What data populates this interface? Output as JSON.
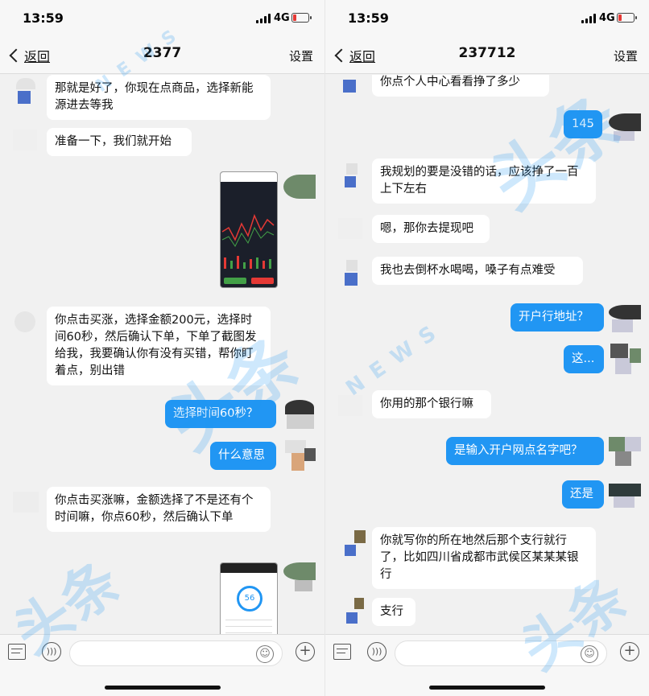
{
  "left": {
    "status": {
      "time": "13:59",
      "network": "4G"
    },
    "nav": {
      "back": "返回",
      "title": "2377",
      "settings": "设置"
    },
    "messages": [
      {
        "side": "in",
        "text": "那就是好了，你现在点商品，选择新能源进去等我"
      },
      {
        "side": "in",
        "text": "准备一下，我们就开始"
      },
      {
        "side": "out",
        "type": "image",
        "label": "trading-chart-screenshot"
      },
      {
        "side": "in",
        "text": "你点击买涨，选择金额200元，选择时间60秒，然后确认下单，下单了截图发给我，我要确认你有没有买错，帮你盯着点，别出错"
      },
      {
        "side": "out",
        "text": "选择时间60秒？"
      },
      {
        "side": "out",
        "text": "什么意思"
      },
      {
        "side": "in",
        "text": "你点击买涨嘛，金额选择了不是还有个时间嘛，你点60秒，然后确认下单"
      },
      {
        "side": "out",
        "type": "image",
        "label": "order-countdown-screenshot"
      }
    ],
    "thumb2": {
      "countdown": "56"
    }
  },
  "right": {
    "status": {
      "time": "13:59",
      "network": "4G"
    },
    "nav": {
      "back": "返回",
      "title": "237712",
      "settings": "设置"
    },
    "messages": [
      {
        "side": "in",
        "text": "你点个人中心看看挣了多少"
      },
      {
        "side": "out",
        "text": "145"
      },
      {
        "side": "in",
        "text": "我规划的要是没错的话，应该挣了一百上下左右"
      },
      {
        "side": "in",
        "text": "嗯，那你去提现吧"
      },
      {
        "side": "in",
        "text": "我也去倒杯水喝喝，嗓子有点难受"
      },
      {
        "side": "out",
        "text": "开户行地址？"
      },
      {
        "side": "out",
        "text": "这..."
      },
      {
        "side": "in",
        "text": "你用的那个银行嘛"
      },
      {
        "side": "out",
        "text": "是输入开户网点名字吧？"
      },
      {
        "side": "out",
        "text": "还是"
      },
      {
        "side": "in",
        "text": "你就写你的所在地然后那个支行就行了，比如四川省成都市武侯区某某某银行"
      },
      {
        "side": "in",
        "text": "支行"
      }
    ]
  },
  "watermark": {
    "text": "头条",
    "sub": "NEWS"
  },
  "colors": {
    "out_bubble": "#2196f3",
    "in_bubble": "#ffffff",
    "bg": "#f1f1f1"
  },
  "icons": [
    "menu-icon",
    "voice-icon",
    "emoji-icon",
    "plus-icon"
  ]
}
